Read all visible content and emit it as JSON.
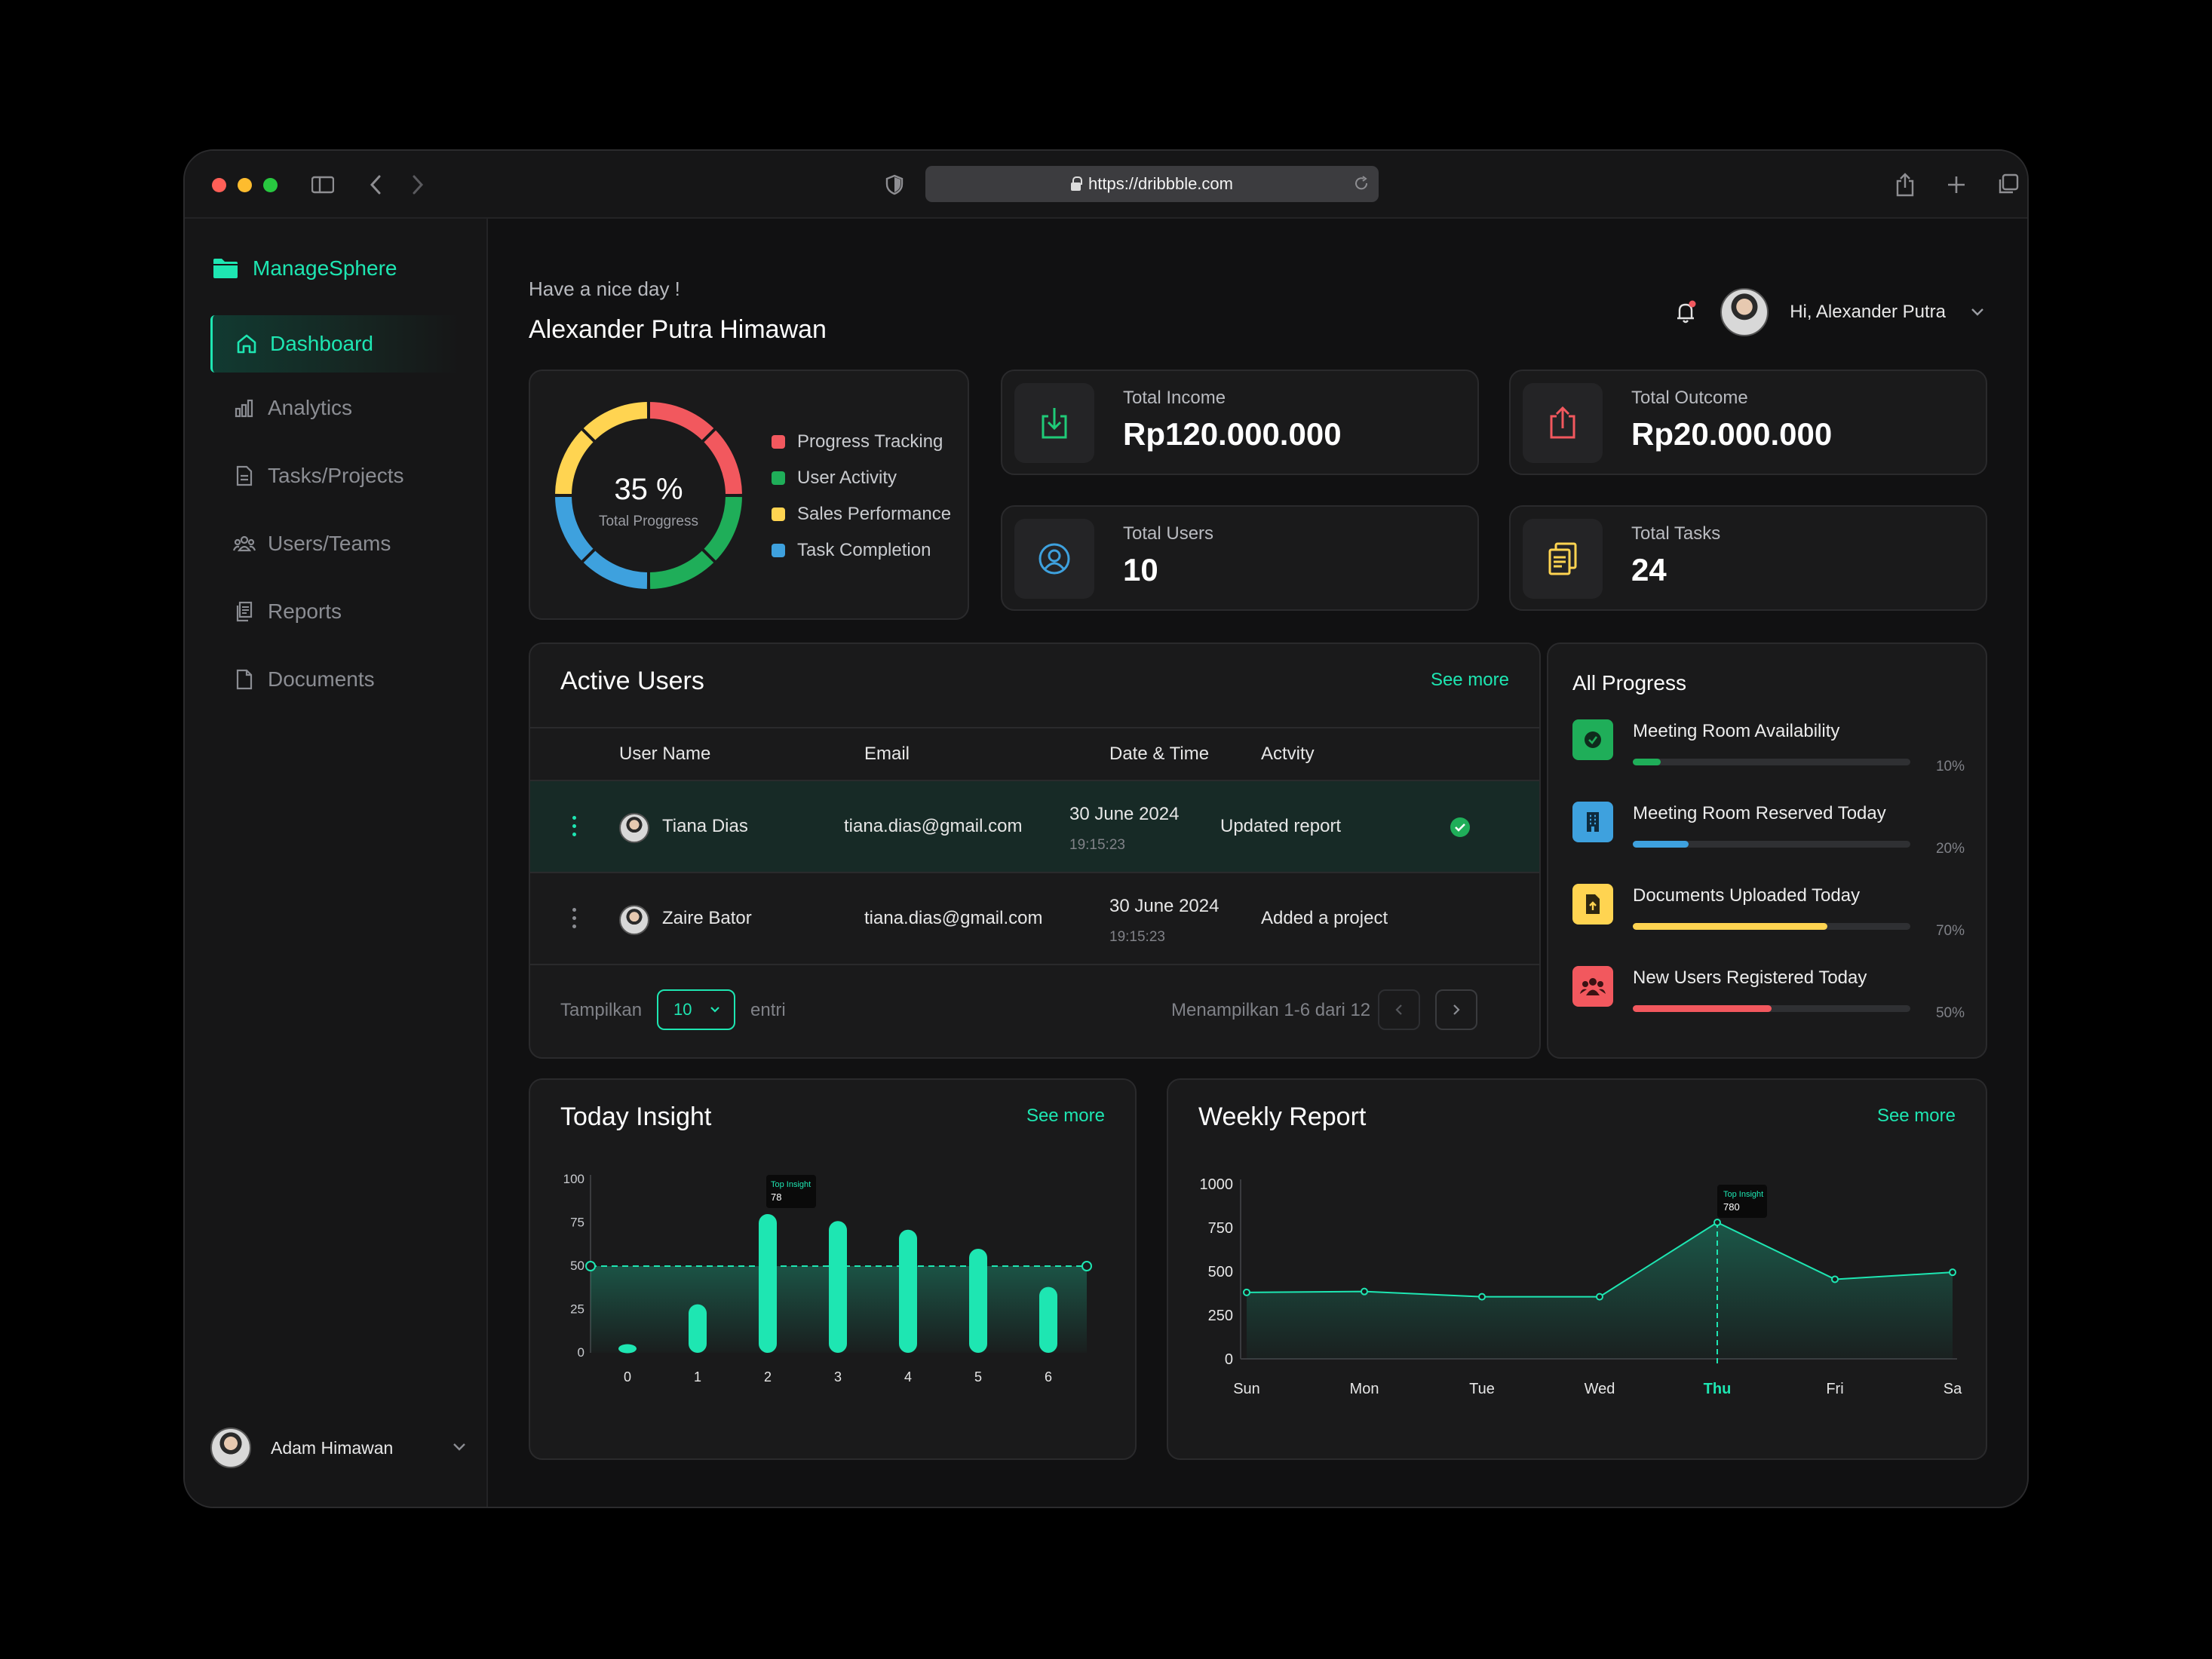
{
  "browser": {
    "url": "https://dribbble.com"
  },
  "sidebar": {
    "brand": "ManageSphere",
    "items": [
      {
        "label": "Dashboard"
      },
      {
        "label": "Analytics"
      },
      {
        "label": "Tasks/Projects"
      },
      {
        "label": "Users/Teams"
      },
      {
        "label": "Reports"
      },
      {
        "label": "Documents"
      }
    ],
    "profile_name": "Adam Himawan"
  },
  "header": {
    "greeting": "Have a nice day !",
    "name": "Alexander Putra Himawan",
    "user_greeting": "Hi, Alexander Putra"
  },
  "progress_donut": {
    "value": "35 %",
    "label": "Total Proggress",
    "legend": [
      {
        "label": "Progress Tracking",
        "color": "#f2585e"
      },
      {
        "label": "User Activity",
        "color": "#1fae59"
      },
      {
        "label": "Sales Performance",
        "color": "#ffd451"
      },
      {
        "label": "Task Completion",
        "color": "#3ea1de"
      }
    ]
  },
  "stats": [
    {
      "label": "Total Income",
      "value": "Rp120.000.000",
      "icon": "download-icon",
      "color": "#1fcb78"
    },
    {
      "label": "Total Outcome",
      "value": "Rp20.000.000",
      "icon": "upload-icon",
      "color": "#f2585e"
    },
    {
      "label": "Total Users",
      "value": "10",
      "icon": "user-icon",
      "color": "#3ea1de"
    },
    {
      "label": "Total Tasks",
      "value": "24",
      "icon": "clipboard-icon",
      "color": "#ffd451"
    }
  ],
  "active_users": {
    "title": "Active Users",
    "see_more": "See more",
    "columns": [
      "User Name",
      "Email",
      "Date & Time",
      "Actvity"
    ],
    "rows": [
      {
        "name": "Tiana Dias",
        "email": "tiana.dias@gmail.com",
        "date": "30 June 2024",
        "time": "19:15:23",
        "activity": "Updated report"
      },
      {
        "name": "Zaire Bator",
        "email": "tiana.dias@gmail.com",
        "date": "30 June 2024",
        "time": "19:15:23",
        "activity": "Added a project"
      }
    ],
    "show_label": "Tampilkan",
    "page_size": "10",
    "entries_label": "entri",
    "range_text": "Menampilkan 1-6 dari 12"
  },
  "all_progress": {
    "title": "All Progress",
    "items": [
      {
        "label": "Meeting Room Availability",
        "pct_text": "10%",
        "pct": 10,
        "color": "#1fae59",
        "icon": "check-icon"
      },
      {
        "label": "Meeting Room Reserved Today",
        "pct_text": "20%",
        "pct": 20,
        "color": "#3ea1de",
        "icon": "building-icon"
      },
      {
        "label": "Documents Uploaded Today",
        "pct_text": "70%",
        "pct": 70,
        "color": "#ffd451",
        "icon": "document-upload-icon"
      },
      {
        "label": "New Users Registered Today",
        "pct_text": "50%",
        "pct": 50,
        "color": "#f2585e",
        "icon": "users-icon"
      }
    ]
  },
  "today_insight": {
    "title": "Today Insight",
    "see_more": "See more",
    "tooltip_title": "Top Insight",
    "tooltip_value": "78"
  },
  "weekly_report": {
    "title": "Weekly Report",
    "see_more": "See more",
    "tooltip_title": "Top Insight",
    "tooltip_value": "780"
  },
  "chart_data": [
    {
      "type": "bar",
      "title": "Today Insight",
      "categories": [
        "0",
        "1",
        "2",
        "3",
        "4",
        "5",
        "6"
      ],
      "values": [
        5,
        28,
        80,
        76,
        71,
        60,
        38
      ],
      "reference_line": 50,
      "ylim": [
        0,
        100
      ],
      "yticks": [
        "0",
        "25",
        "50",
        "75",
        "100"
      ],
      "color": "#1ee6b2"
    },
    {
      "type": "area",
      "title": "Weekly Report",
      "categories": [
        "Sun",
        "Mon",
        "Tue",
        "Wed",
        "Thu",
        "Fri",
        "Sa"
      ],
      "values": [
        380,
        385,
        355,
        355,
        780,
        455,
        495
      ],
      "highlight": "Thu",
      "ylim": [
        0,
        1000
      ],
      "yticks": [
        "0",
        "250",
        "500",
        "750",
        "1000"
      ],
      "color": "#1ee6b2"
    }
  ]
}
